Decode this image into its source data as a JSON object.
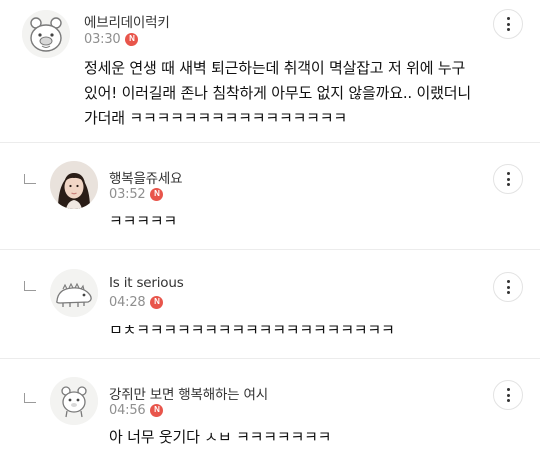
{
  "comments": [
    {
      "nickname": "에브리데이럭키",
      "time": "03:30",
      "badge": "N",
      "text_lines": [
        "정세운 연생 때 새벽 퇴근하는데 취객이 멱살잡고 저 위에 누구",
        "있어! 이러길래 존나 침착하게 아무도 없지 않을까요.. 이랬더니",
        "가더래 ㅋㅋㅋㅋㅋㅋㅋㅋㅋㅋㅋㅋㅋㅋㅋㅋ"
      ],
      "avatar_icon": "hamster-avatar-icon"
    },
    {
      "nickname": "행복을쥬세요",
      "time": "03:52",
      "badge": "N",
      "text_lines": [
        "ㅋㅋㅋㅋㅋ"
      ],
      "avatar_icon": "profile-photo-avatar"
    },
    {
      "nickname": "Is it serious",
      "time": "04:28",
      "badge": "N",
      "text_lines": [
        "ㅁㅊㅋㅋㅋㅋㅋㅋㅋㅋㅋㅋㅋㅋㅋㅋㅋㅋㅋㅋㅋ"
      ],
      "avatar_icon": "dinosaur-avatar-icon"
    },
    {
      "nickname": "강쥐만 보면 행복해하는 여시",
      "time": "04:56",
      "badge": "N",
      "text_lines": [
        "아 너무 웃기다 ㅅㅂ ㅋㅋㅋㅋㅋㅋㅋ"
      ],
      "avatar_icon": "bear-avatar-icon"
    }
  ],
  "colors": {
    "badge": "#e8554b",
    "time": "#8f8f8f",
    "divider": "#ececec"
  },
  "icons": {
    "more": "more-vertical-icon",
    "reply": "reply-arrow-icon"
  }
}
